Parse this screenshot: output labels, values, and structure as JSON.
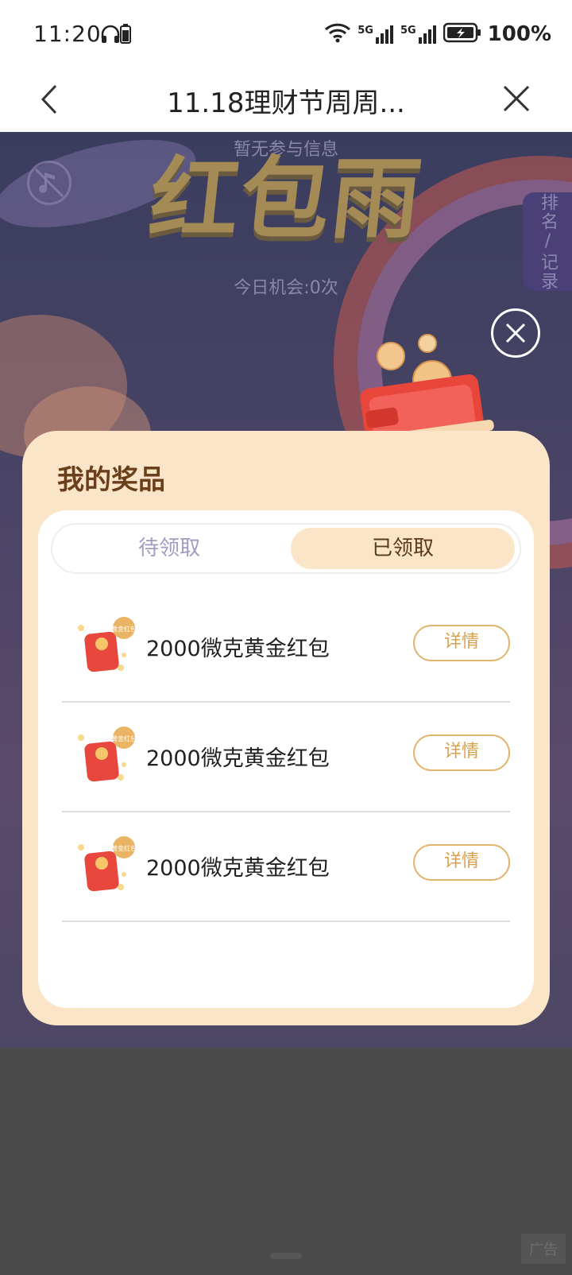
{
  "status_bar": {
    "time": "11:20",
    "network_1": "5G",
    "network_2": "5G",
    "battery": "100%"
  },
  "nav": {
    "title": "11.18理财节周周..."
  },
  "game": {
    "no_info": "暂无参与信息",
    "banner_title": "红包雨",
    "chances": "今日机会:0次",
    "rank_tab": "排名/记录"
  },
  "modal": {
    "title": "我的奖品",
    "tabs": [
      {
        "label": "待领取",
        "active": false
      },
      {
        "label": "已领取",
        "active": true
      }
    ],
    "prizes": [
      {
        "name": "2000微克黄金红包",
        "detail_label": "详情",
        "icon_badge": "黄金红包"
      },
      {
        "name": "2000微克黄金红包",
        "detail_label": "详情",
        "icon_badge": "黄金红包"
      },
      {
        "name": "2000微克黄金红包",
        "detail_label": "详情",
        "icon_badge": "黄金红包"
      }
    ]
  },
  "ad_label": "广告",
  "colors": {
    "modal_bg": "#fbe5c8",
    "accent_gold": "#e0b56e",
    "title_brown": "#6a3f1c"
  }
}
